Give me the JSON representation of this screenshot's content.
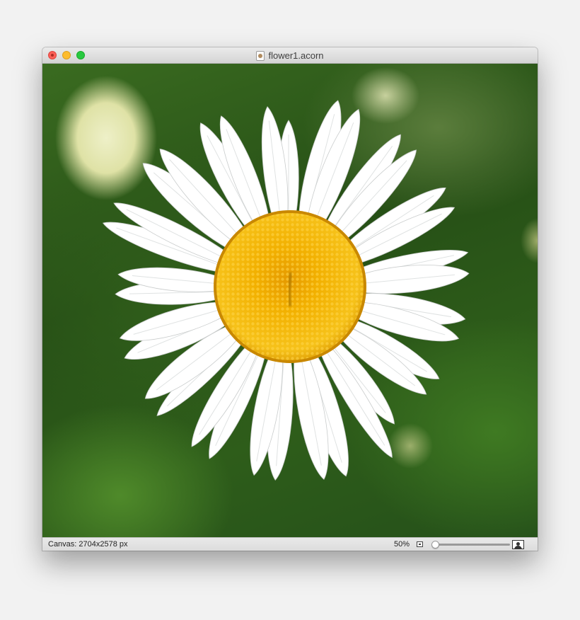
{
  "window": {
    "title": "flower1.acorn",
    "icons": {
      "close": "close-icon",
      "minimize": "minimize-icon",
      "zoom": "zoom-icon",
      "document": "acorn-document-icon"
    }
  },
  "canvas": {
    "image": "white daisy flower on green background"
  },
  "status": {
    "canvas_label": "Canvas: 2704x2578 px",
    "zoom_percent": "50%",
    "zoom_slider_value": 0.0,
    "icons": {
      "zoom_out": "small-image-icon",
      "zoom_in": "large-image-icon"
    }
  },
  "colors": {
    "petal": "#ffffff",
    "center": "#f2b400",
    "background": "#2e5d1a",
    "close": "#fc5f57",
    "minimize": "#fdbc2e",
    "zoom": "#28c940"
  }
}
